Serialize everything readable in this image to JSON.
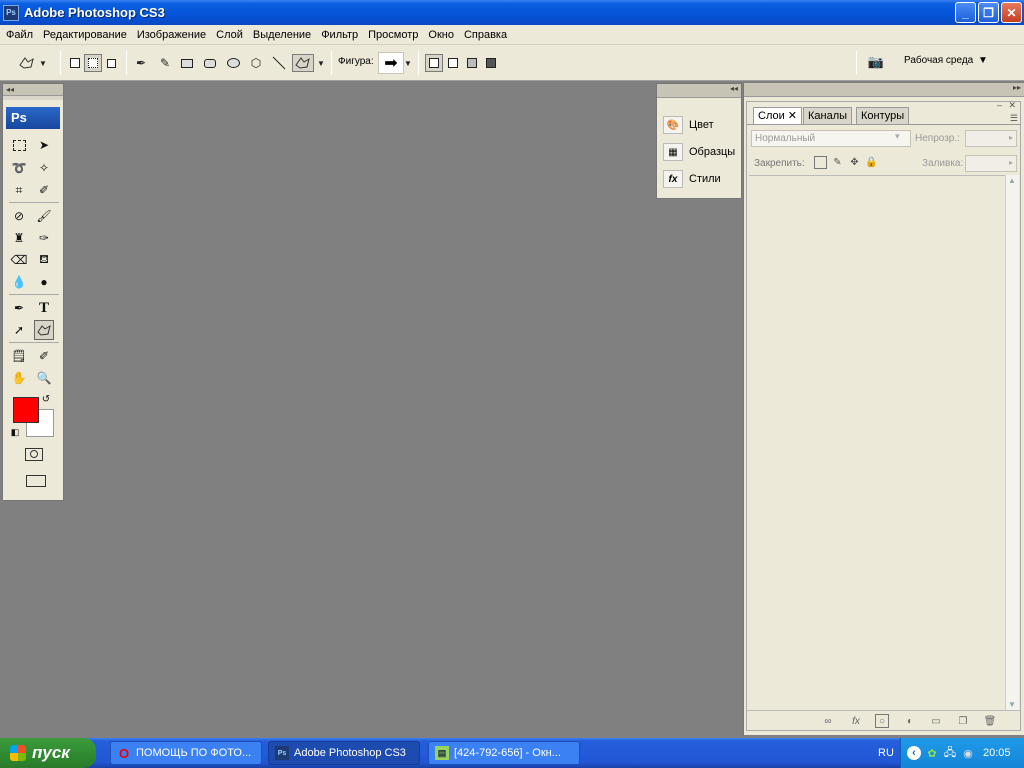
{
  "window": {
    "icon_text": "Ps",
    "title": "Adobe Photoshop CS3",
    "minimize": "_",
    "maximize": "❐",
    "close": "✕"
  },
  "menu": [
    "Файл",
    "Редактирование",
    "Изображение",
    "Слой",
    "Выделение",
    "Фильтр",
    "Просмотр",
    "Окно",
    "Справка"
  ],
  "options_bar": {
    "shape_label": "Фигура:",
    "shape_value": "➡",
    "workspace": "Рабочая среда",
    "workspace_arrow": "▼"
  },
  "toolbox": {
    "logo": "Ps",
    "foreground_color": "#ff0000",
    "background_color": "#ffffff"
  },
  "small_dock": {
    "items": [
      {
        "label": "Цвет",
        "icon": "color-palette-icon"
      },
      {
        "label": "Образцы",
        "icon": "swatches-grid-icon"
      },
      {
        "label": "Стили",
        "icon": "fx-styles-icon"
      }
    ]
  },
  "layers_panel": {
    "tabs": [
      {
        "label": "Слои ✕",
        "active": true
      },
      {
        "label": "Каналы",
        "active": false
      },
      {
        "label": "Контуры",
        "active": false
      }
    ],
    "blend_mode": "Нормальный",
    "opacity_label": "Непрозр.:",
    "lock_label": "Закрепить:",
    "fill_label": "Заливка:"
  },
  "taskbar": {
    "start": "пуск",
    "tasks": [
      {
        "label": "ПОМОЩЬ ПО ФОТО...",
        "icon": "opera-icon",
        "active": false
      },
      {
        "label": "Adobe Photoshop CS3",
        "icon": "photoshop-icon",
        "active": true
      },
      {
        "label": "[424-792-656] - Окн...",
        "icon": "chat-window-icon",
        "active": false
      }
    ],
    "language": "RU",
    "clock": "20:05"
  }
}
